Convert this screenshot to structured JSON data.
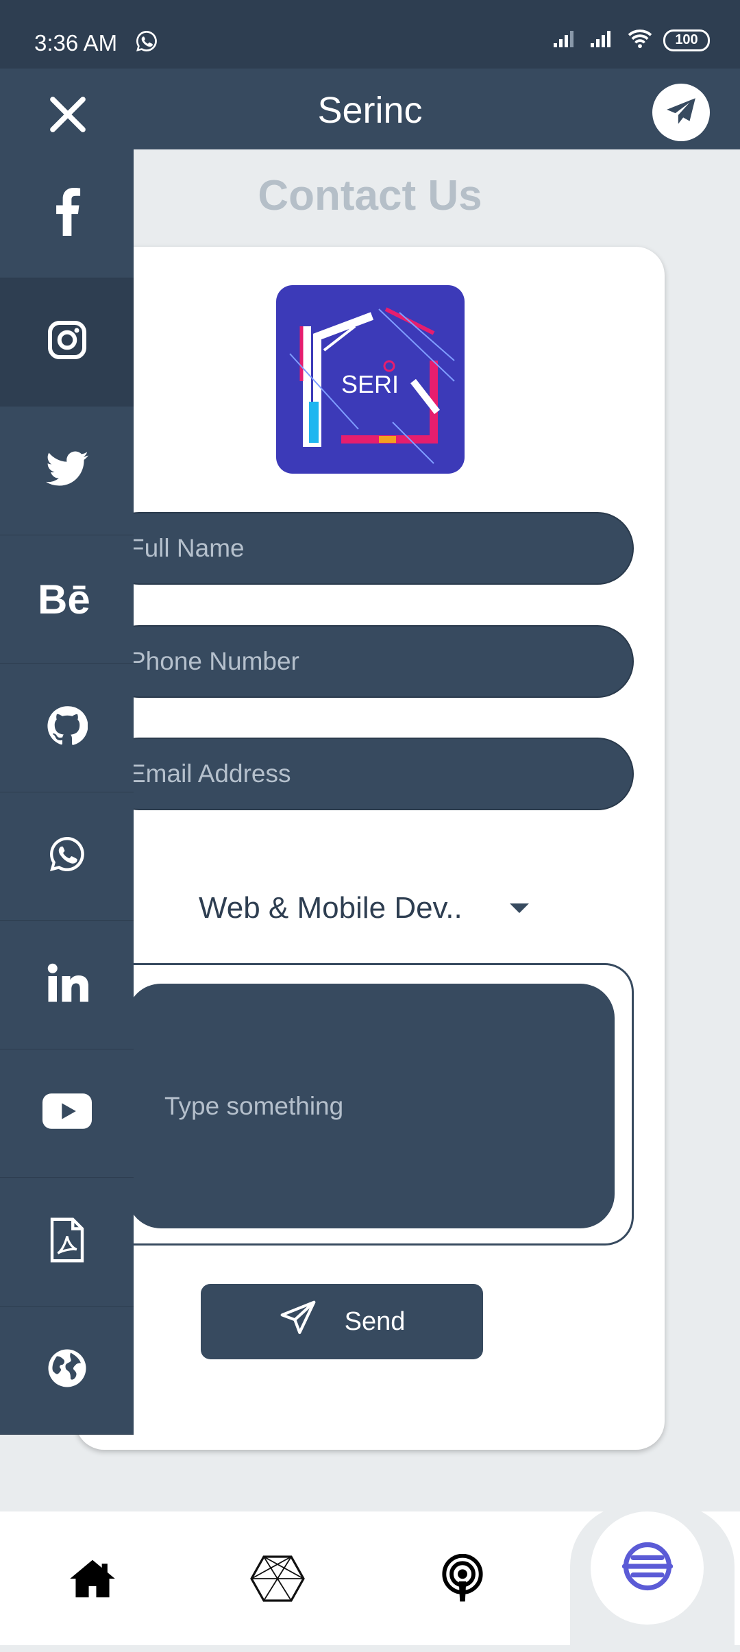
{
  "status_bar": {
    "time": "3:36 AM",
    "battery": "100"
  },
  "app_bar": {
    "title": "Serinc"
  },
  "page": {
    "heading": "Contact Us"
  },
  "logo": {
    "text": "SERI"
  },
  "form": {
    "full_name_placeholder": "Full Name",
    "phone_placeholder": "Phone Number",
    "email_placeholder": "Email Address",
    "service_selected": "Web & Mobile Dev..",
    "message_placeholder": "Type something",
    "send_label": "Send"
  },
  "social_links": [
    {
      "icon": "facebook-icon"
    },
    {
      "icon": "instagram-icon"
    },
    {
      "icon": "twitter-icon"
    },
    {
      "icon": "behance-icon"
    },
    {
      "icon": "github-icon"
    },
    {
      "icon": "whatsapp-icon"
    },
    {
      "icon": "linkedin-icon"
    },
    {
      "icon": "youtube-icon"
    },
    {
      "icon": "pdf-icon"
    },
    {
      "icon": "globe-icon"
    }
  ],
  "bottom_nav": [
    {
      "icon": "home-icon"
    },
    {
      "icon": "hexagon-network-icon"
    },
    {
      "icon": "podcast-icon"
    },
    {
      "icon": "contact-active-icon"
    }
  ],
  "colors": {
    "primary": "#374a5f",
    "background": "#e9ecee",
    "accent": "#5b5bd6",
    "logo_bg": "#3c3ab8"
  }
}
